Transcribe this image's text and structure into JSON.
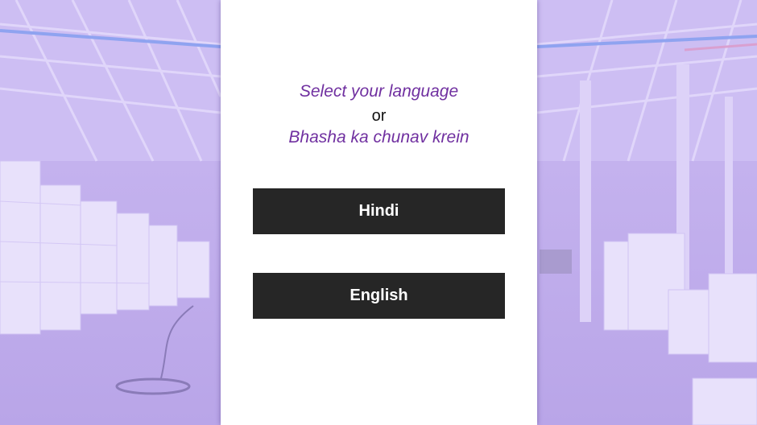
{
  "prompt": {
    "english": "Select your language",
    "separator": "or",
    "hindi": "Bhasha ka chunav krein"
  },
  "buttons": {
    "hindi_label": "Hindi",
    "english_label": "English"
  },
  "colors": {
    "accent_text": "#7030a0",
    "button_bg": "#262626",
    "button_text": "#ffffff",
    "background_tint": "#c9b8f0"
  }
}
